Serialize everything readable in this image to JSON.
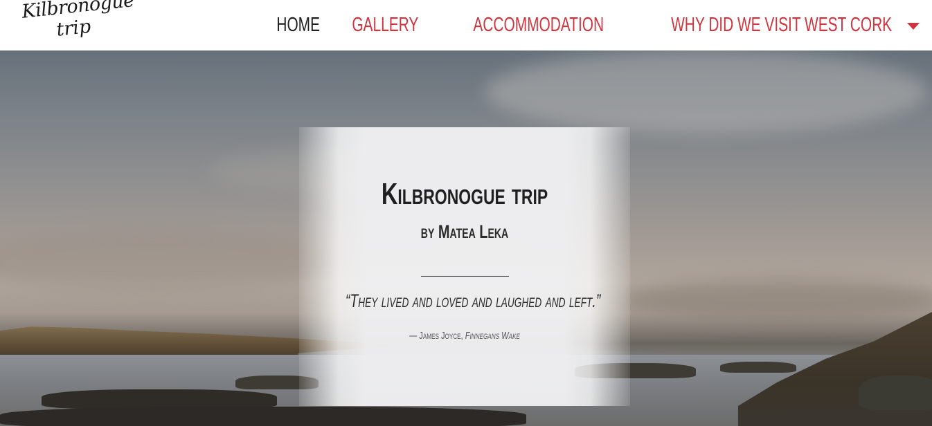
{
  "header": {
    "logo": {
      "line1": "Kilbronogue",
      "line2": "trip"
    },
    "nav": {
      "home": "HOME",
      "gallery": "GALLERY",
      "accommodation": "ACCOMMODATION",
      "why": "WHY DID WE VISIT WEST CORK"
    },
    "active_item": "home",
    "accent_color": "#d0343f"
  },
  "hero": {
    "title": "Kilbronogue trip",
    "subtitle": "by Matea Leka",
    "quote": "“They lived and loved and laughed and left.”",
    "cite_author": "— James Joyce, ",
    "cite_work": "Finnegans Wake"
  }
}
